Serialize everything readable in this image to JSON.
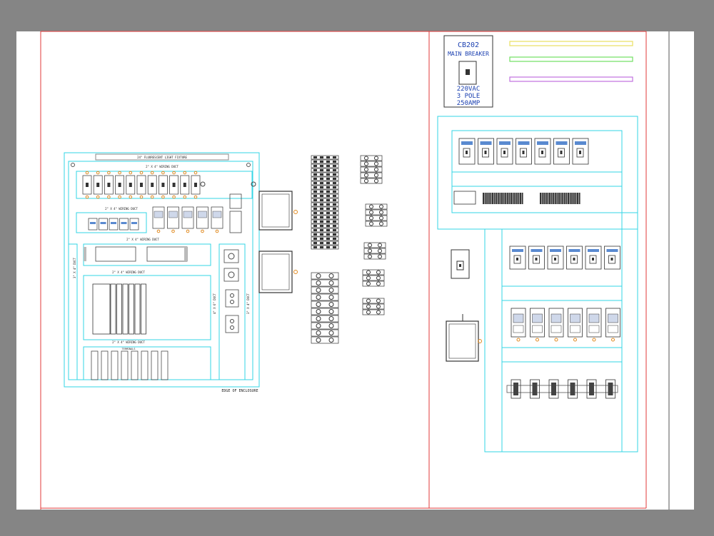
{
  "breaker_box": {
    "title_line1": "CB202",
    "title_line2": "MAIN BREAKER",
    "rating_line1": "220VAC",
    "rating_line2": "3 POLE",
    "rating_line3": "250AMP"
  },
  "left_panel": {
    "fixture_label": "24\" FLUORESCENT LIGHT FIXTURE",
    "duct_top": "2\" X 4\" WIRING DUCT",
    "duct_mid": "2\" X 4\" WIRING DUCT",
    "duct_row3": "2\" X 4\" WIRING DUCT",
    "duct_row4": "2\" X 4\" WIRING DUCT",
    "duct_bottom": "2\" X 4\" WIRING DUCT",
    "terminals_label": "TERMINALS",
    "edge_label": "EDGE OF ENCLOSURE",
    "vertical_duct_left": "3\" X 4\" DUCT",
    "vertical_duct_right": "3\" X 4\" DUCT",
    "vertical_duct_mid": "4\" X 6\" DUCT"
  },
  "legend_colors": [
    "#e8e060",
    "#70e060",
    "#c070e0"
  ],
  "colors": {
    "cyan": "#33d6e6",
    "red": "#e03a3a",
    "orange": "#e08a20",
    "ink": "#1a1a1a"
  }
}
